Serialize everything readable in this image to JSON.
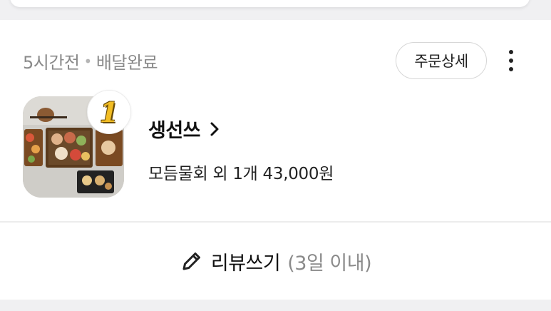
{
  "order": {
    "time_ago": "5시간전",
    "separator": "•",
    "status": "배달완료",
    "detail_button_label": "주문상세",
    "more_icon": "more-vertical-icon",
    "store": {
      "name": "생선쓰",
      "rank": "1",
      "chevron_icon": "chevron-right-icon"
    },
    "summary": "모듬물회 외 1개 43,000원"
  },
  "review": {
    "label": "리뷰쓰기",
    "deadline": "(3일 이내)",
    "icon": "pencil-icon"
  },
  "colors": {
    "background": "#f0f0f2",
    "card": "#ffffff",
    "muted_text": "#8a8a8a",
    "badge_gold": "#f2bd23"
  }
}
